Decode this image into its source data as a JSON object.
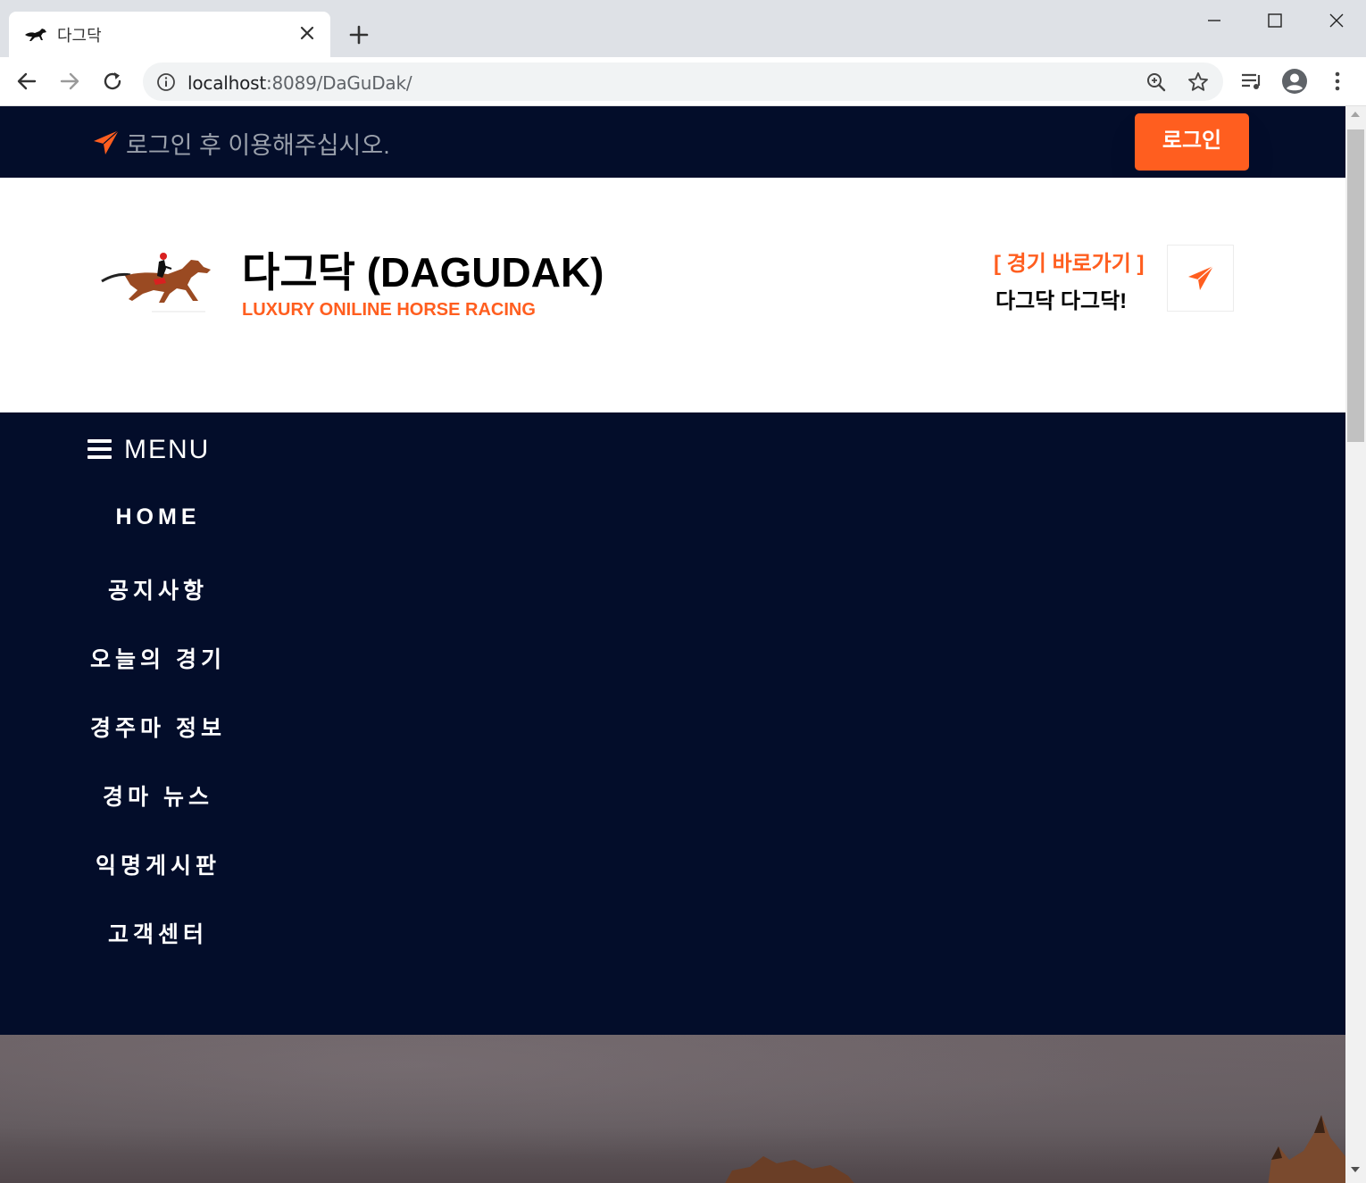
{
  "browser": {
    "tab_title": "다그닥",
    "url_host": "localhost",
    "url_rest": ":8089/DaGuDak/"
  },
  "topbar": {
    "message": "로그인 후 이용해주십시오.",
    "login_label": "로그인"
  },
  "header": {
    "title": "다그닥 (DAGUDAK)",
    "subtitle": "LUXURY ONILINE HORSE RACING",
    "quick_label": "[ 경기 바로가기 ]",
    "quick_text": "다그닥 다그닥!"
  },
  "nav": {
    "menu_label": "MENU",
    "items": [
      {
        "label": "HOME"
      },
      {
        "label": "공지사항"
      },
      {
        "label": "오늘의 경기"
      },
      {
        "label": "경주마 정보"
      },
      {
        "label": "경마 뉴스"
      },
      {
        "label": "익명게시판"
      },
      {
        "label": "고객센터"
      }
    ]
  },
  "colors": {
    "navy": "#030d2a",
    "accent": "#ff5e1f"
  }
}
